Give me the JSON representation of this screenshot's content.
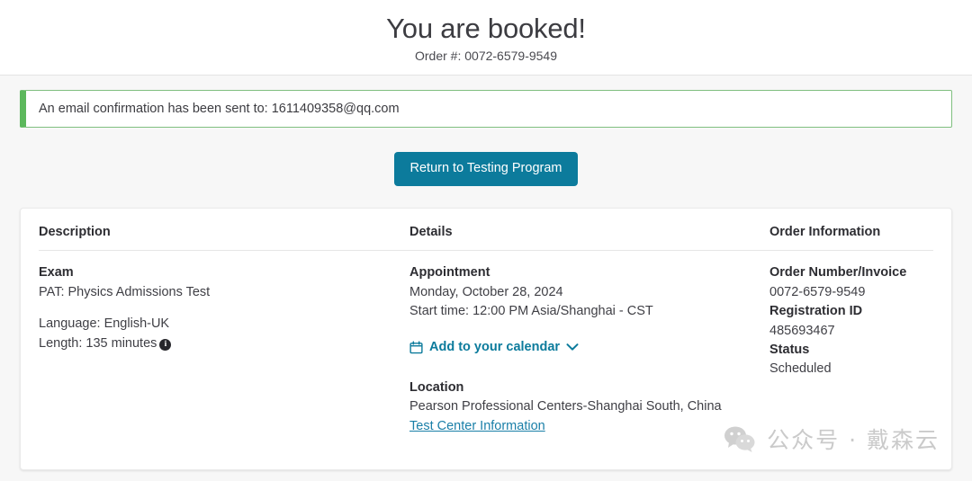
{
  "header": {
    "title": "You are booked!",
    "order_subtitle": "Order #: 0072-6579-9549"
  },
  "alert": {
    "message": "An email confirmation has been sent to: 1611409358@qq.com",
    "border_color": "#5cb85c"
  },
  "actions": {
    "return_button_label": "Return to Testing Program",
    "accent_color": "#0c7b9c"
  },
  "card": {
    "columns": {
      "description_header": "Description",
      "details_header": "Details",
      "order_header": "Order Information"
    },
    "description": {
      "exam_label": "Exam",
      "exam_name": "PAT: Physics Admissions Test",
      "language": "Language: English-UK",
      "length": "Length: 135 minutes",
      "info_icon_glyph": "i"
    },
    "details": {
      "appointment_label": "Appointment",
      "appointment_date": "Monday, October 28, 2024",
      "appointment_start": "Start time: 12:00 PM Asia/Shanghai - CST",
      "calendar_link": "Add to your calendar",
      "location_label": "Location",
      "location_name": "Pearson Professional Centers-Shanghai South, China",
      "test_center_link": "Test Center Information"
    },
    "order": {
      "order_number_label": "Order Number/Invoice",
      "order_number_value": "0072-6579-9549",
      "registration_id_label": "Registration ID",
      "registration_id_value": "485693467",
      "status_label": "Status",
      "status_value": "Scheduled"
    }
  },
  "watermark": {
    "text": "公众号 · 戴森云"
  }
}
